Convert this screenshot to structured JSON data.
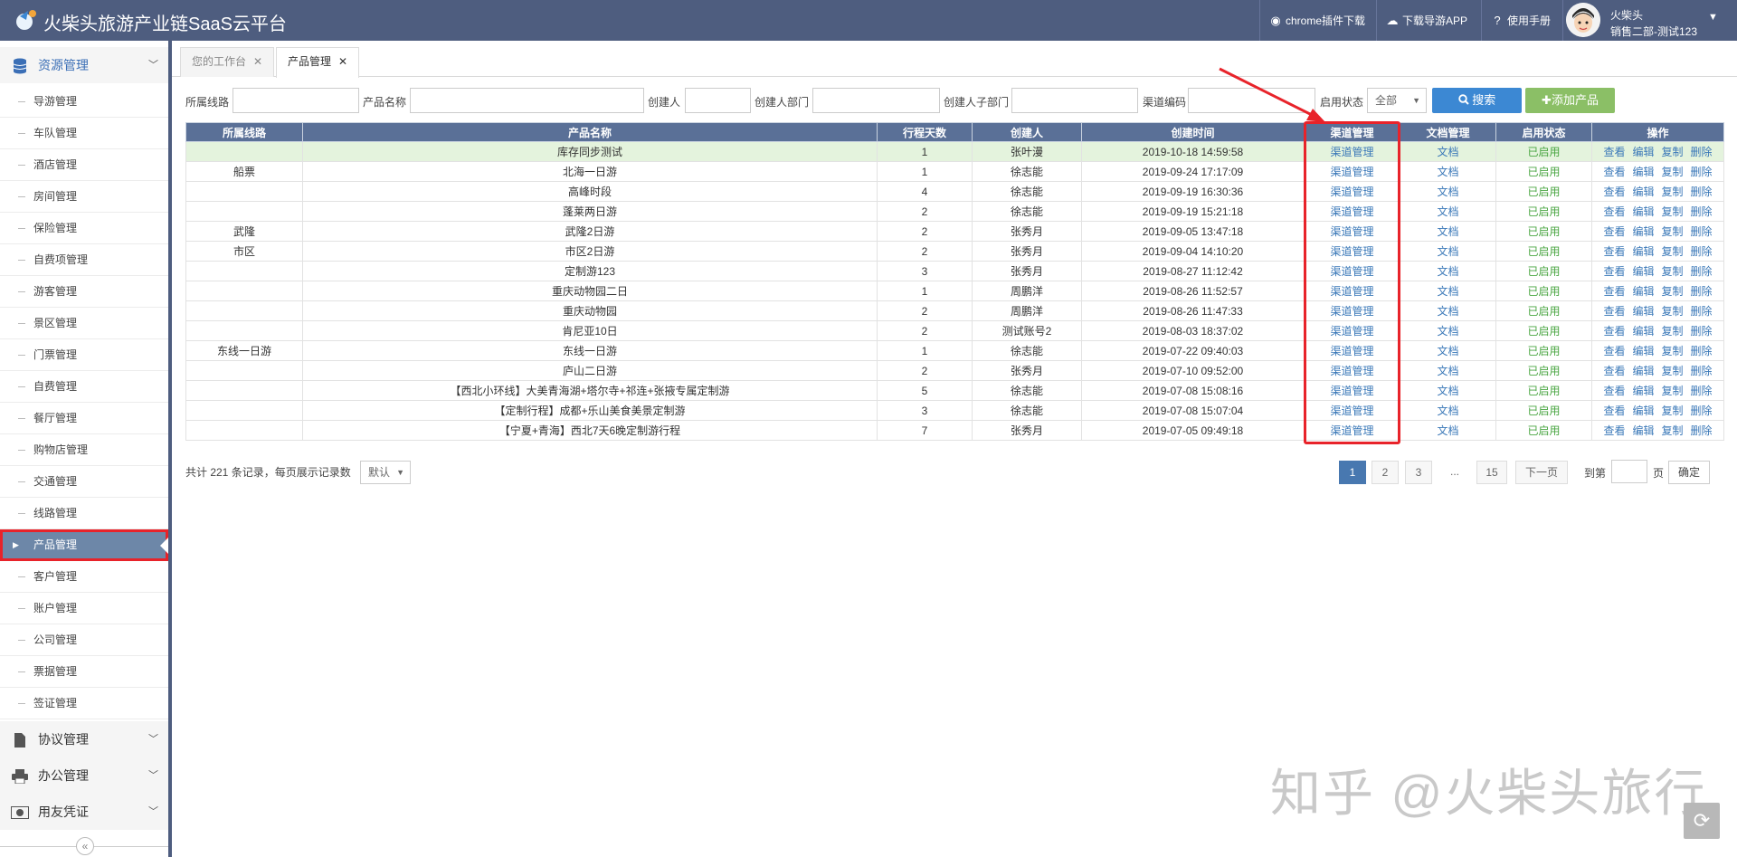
{
  "header": {
    "title": "火柴头旅游产业链SaaS云平台",
    "chrome_plugin": "chrome插件下载",
    "download_app": "下载导游APP",
    "manual": "使用手册",
    "user_name": "火柴头",
    "user_dept": "销售二部-测试123"
  },
  "sidebar": {
    "group1": "资源管理",
    "items": [
      "导游管理",
      "车队管理",
      "酒店管理",
      "房间管理",
      "保险管理",
      "自费项管理",
      "游客管理",
      "景区管理",
      "门票管理",
      "自费管理",
      "餐厅管理",
      "购物店管理",
      "交通管理",
      "线路管理",
      "产品管理",
      "客户管理",
      "账户管理",
      "公司管理",
      "票据管理",
      "签证管理"
    ],
    "active_index": 14,
    "group2": "协议管理",
    "group3": "办公管理",
    "group4": "用友凭证"
  },
  "tabs": [
    "您的工作台",
    "产品管理"
  ],
  "filters": {
    "route": "所属线路",
    "product": "产品名称",
    "creator": "创建人",
    "dept": "创建人部门",
    "subdept": "创建人子部门",
    "channel_code": "渠道编码",
    "status": "启用状态",
    "status_value": "全部",
    "search_btn": "搜索",
    "add_btn": "添加产品"
  },
  "table": {
    "headers": [
      "所属线路",
      "产品名称",
      "行程天数",
      "创建人",
      "创建时间",
      "渠道管理",
      "文档管理",
      "启用状态",
      "操作"
    ],
    "rows": [
      [
        "",
        "库存同步测试",
        "1",
        "张叶漫",
        "2019-10-18 14:59:58"
      ],
      [
        "船票",
        "北海一日游",
        "1",
        "徐志能",
        "2019-09-24 17:17:09"
      ],
      [
        "",
        "高峰时段",
        "4",
        "徐志能",
        "2019-09-19 16:30:36"
      ],
      [
        "",
        "蓬莱两日游",
        "2",
        "徐志能",
        "2019-09-19 15:21:18"
      ],
      [
        "武隆",
        "武隆2日游",
        "2",
        "张秀月",
        "2019-09-05 13:47:18"
      ],
      [
        "市区",
        "市区2日游",
        "2",
        "张秀月",
        "2019-09-04 14:10:20"
      ],
      [
        "",
        "定制游123",
        "3",
        "张秀月",
        "2019-08-27 11:12:42"
      ],
      [
        "",
        "重庆动物园二日",
        "1",
        "周鹏洋",
        "2019-08-26 11:52:57"
      ],
      [
        "",
        "重庆动物园",
        "2",
        "周鹏洋",
        "2019-08-26 11:47:33"
      ],
      [
        "",
        "肯尼亚10日",
        "2",
        "测试账号2",
        "2019-08-03 18:37:02"
      ],
      [
        "东线一日游",
        "东线一日游",
        "1",
        "徐志能",
        "2019-07-22 09:40:03"
      ],
      [
        "",
        "庐山二日游",
        "2",
        "张秀月",
        "2019-07-10 09:52:00"
      ],
      [
        "",
        "【西北小环线】大美青海湖+塔尔寺+祁连+张掖专属定制游",
        "5",
        "徐志能",
        "2019-07-08 15:08:16"
      ],
      [
        "",
        "【定制行程】成都+乐山美食美景定制游",
        "3",
        "徐志能",
        "2019-07-08 15:07:04"
      ],
      [
        "",
        "【宁夏+青海】西北7天6晚定制游行程",
        "7",
        "张秀月",
        "2019-07-05 09:49:18"
      ]
    ],
    "channel_link": "渠道管理",
    "doc_link": "文档",
    "status_text": "已启用",
    "ops": [
      "查看",
      "编辑",
      "复制",
      "删除"
    ]
  },
  "footer": {
    "records": "共计 221 条记录，每页展示记录数",
    "page_size": "默认",
    "pages": [
      "1",
      "2",
      "3",
      "...",
      "15"
    ],
    "next": "下一页",
    "goto": "到第",
    "page_unit": "页",
    "confirm": "确定"
  },
  "watermark": "知乎 @火柴头旅行"
}
